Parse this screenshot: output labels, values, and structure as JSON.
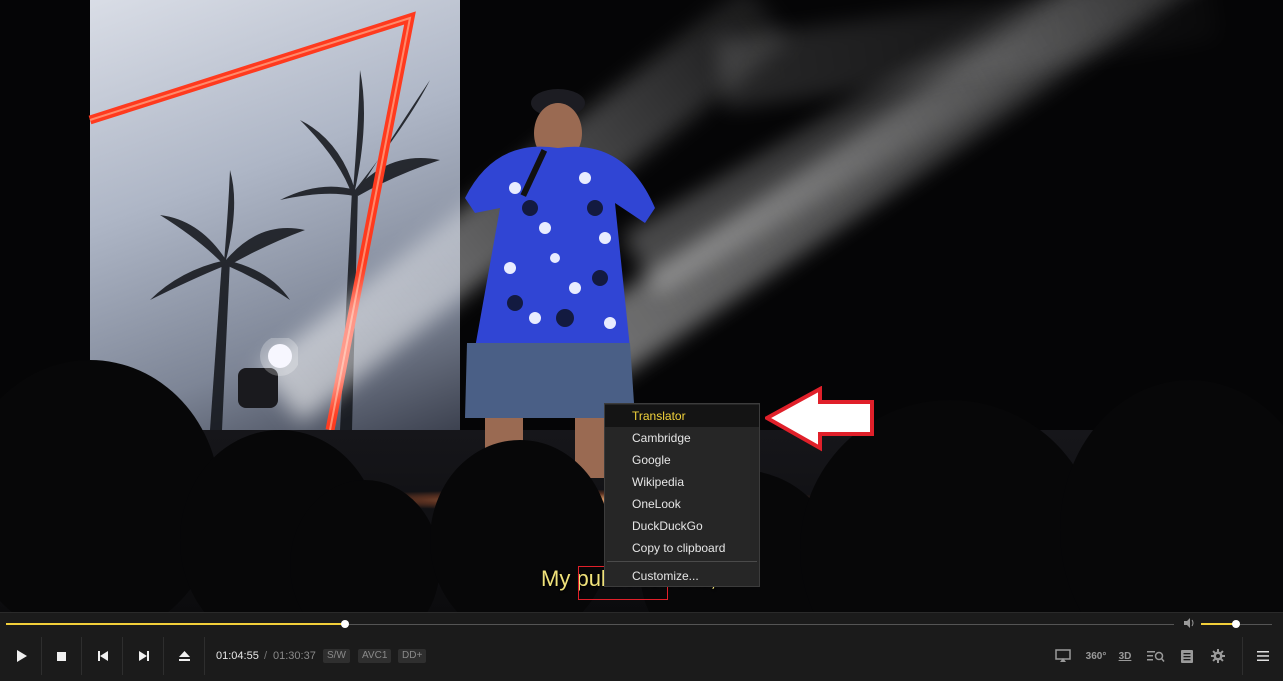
{
  "player": {
    "subtitle": {
      "before": "My ",
      "selected": "publicist",
      "after": "'s like,"
    },
    "context_menu": {
      "items": [
        {
          "label": "Translator",
          "active": true
        },
        {
          "label": "Cambridge"
        },
        {
          "label": "Google"
        },
        {
          "label": "Wikipedia"
        },
        {
          "label": "OneLook"
        },
        {
          "label": "DuckDuckGo"
        },
        {
          "label": "Copy to clipboard"
        }
      ],
      "customize_label": "Customize..."
    },
    "controls": {
      "time_current": "01:04:55",
      "time_separator": "/",
      "time_total": "01:30:37",
      "badges": [
        "S/W",
        "AVC1",
        "DD+"
      ],
      "progress_fraction": 0.29,
      "volume_fraction": 0.49,
      "icons_left": [
        "play-icon",
        "stop-icon",
        "previous-icon",
        "next-icon",
        "eject-icon"
      ],
      "icons_right": [
        "cast-icon",
        "360-icon",
        "3d-icon",
        "search-subtitle-icon",
        "playlist-icon",
        "settings-icon",
        "menu-icon"
      ],
      "label_360": "360°",
      "label_3d": "3D"
    },
    "colors": {
      "accent": "#f2cf3a",
      "subtitle": "#f0e27a",
      "highlight_border": "#e0202a",
      "callout_arrow": "#e0202a"
    }
  }
}
